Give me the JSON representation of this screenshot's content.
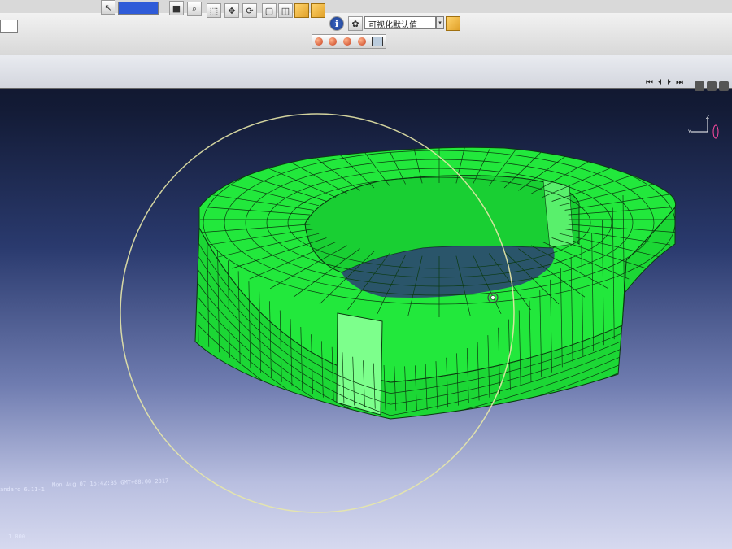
{
  "toolbar": {
    "module_select": "",
    "info_label": "i",
    "visual_default_select": "可视化默认值",
    "dropdown_arrow": "▾"
  },
  "playback": {
    "first": "⏮",
    "prev": "⏴",
    "next": "⏵",
    "last": "⏭"
  },
  "status": {
    "left_label": "andard 6.11-1",
    "timestamp": "Mon Aug 07 16:42:35 GMT+08:00 2017",
    "bottom_left": "1.000"
  },
  "colors": {
    "mesh_fill": "#1fe83a",
    "mesh_highlight": "#7dff8c",
    "mesh_line": "#0b3a10",
    "rotate_circle": "#e7e7a8",
    "viewport_top": "#0a0f1e",
    "viewport_bottom": "#d6d9ef"
  },
  "icons": [
    "select-arrow-icon",
    "zoom-icon",
    "box-zoom-icon",
    "pan-icon",
    "rotate-icon",
    "cube-view-icon",
    "info-icon",
    "render-orb-icon",
    "camera-icon"
  ]
}
